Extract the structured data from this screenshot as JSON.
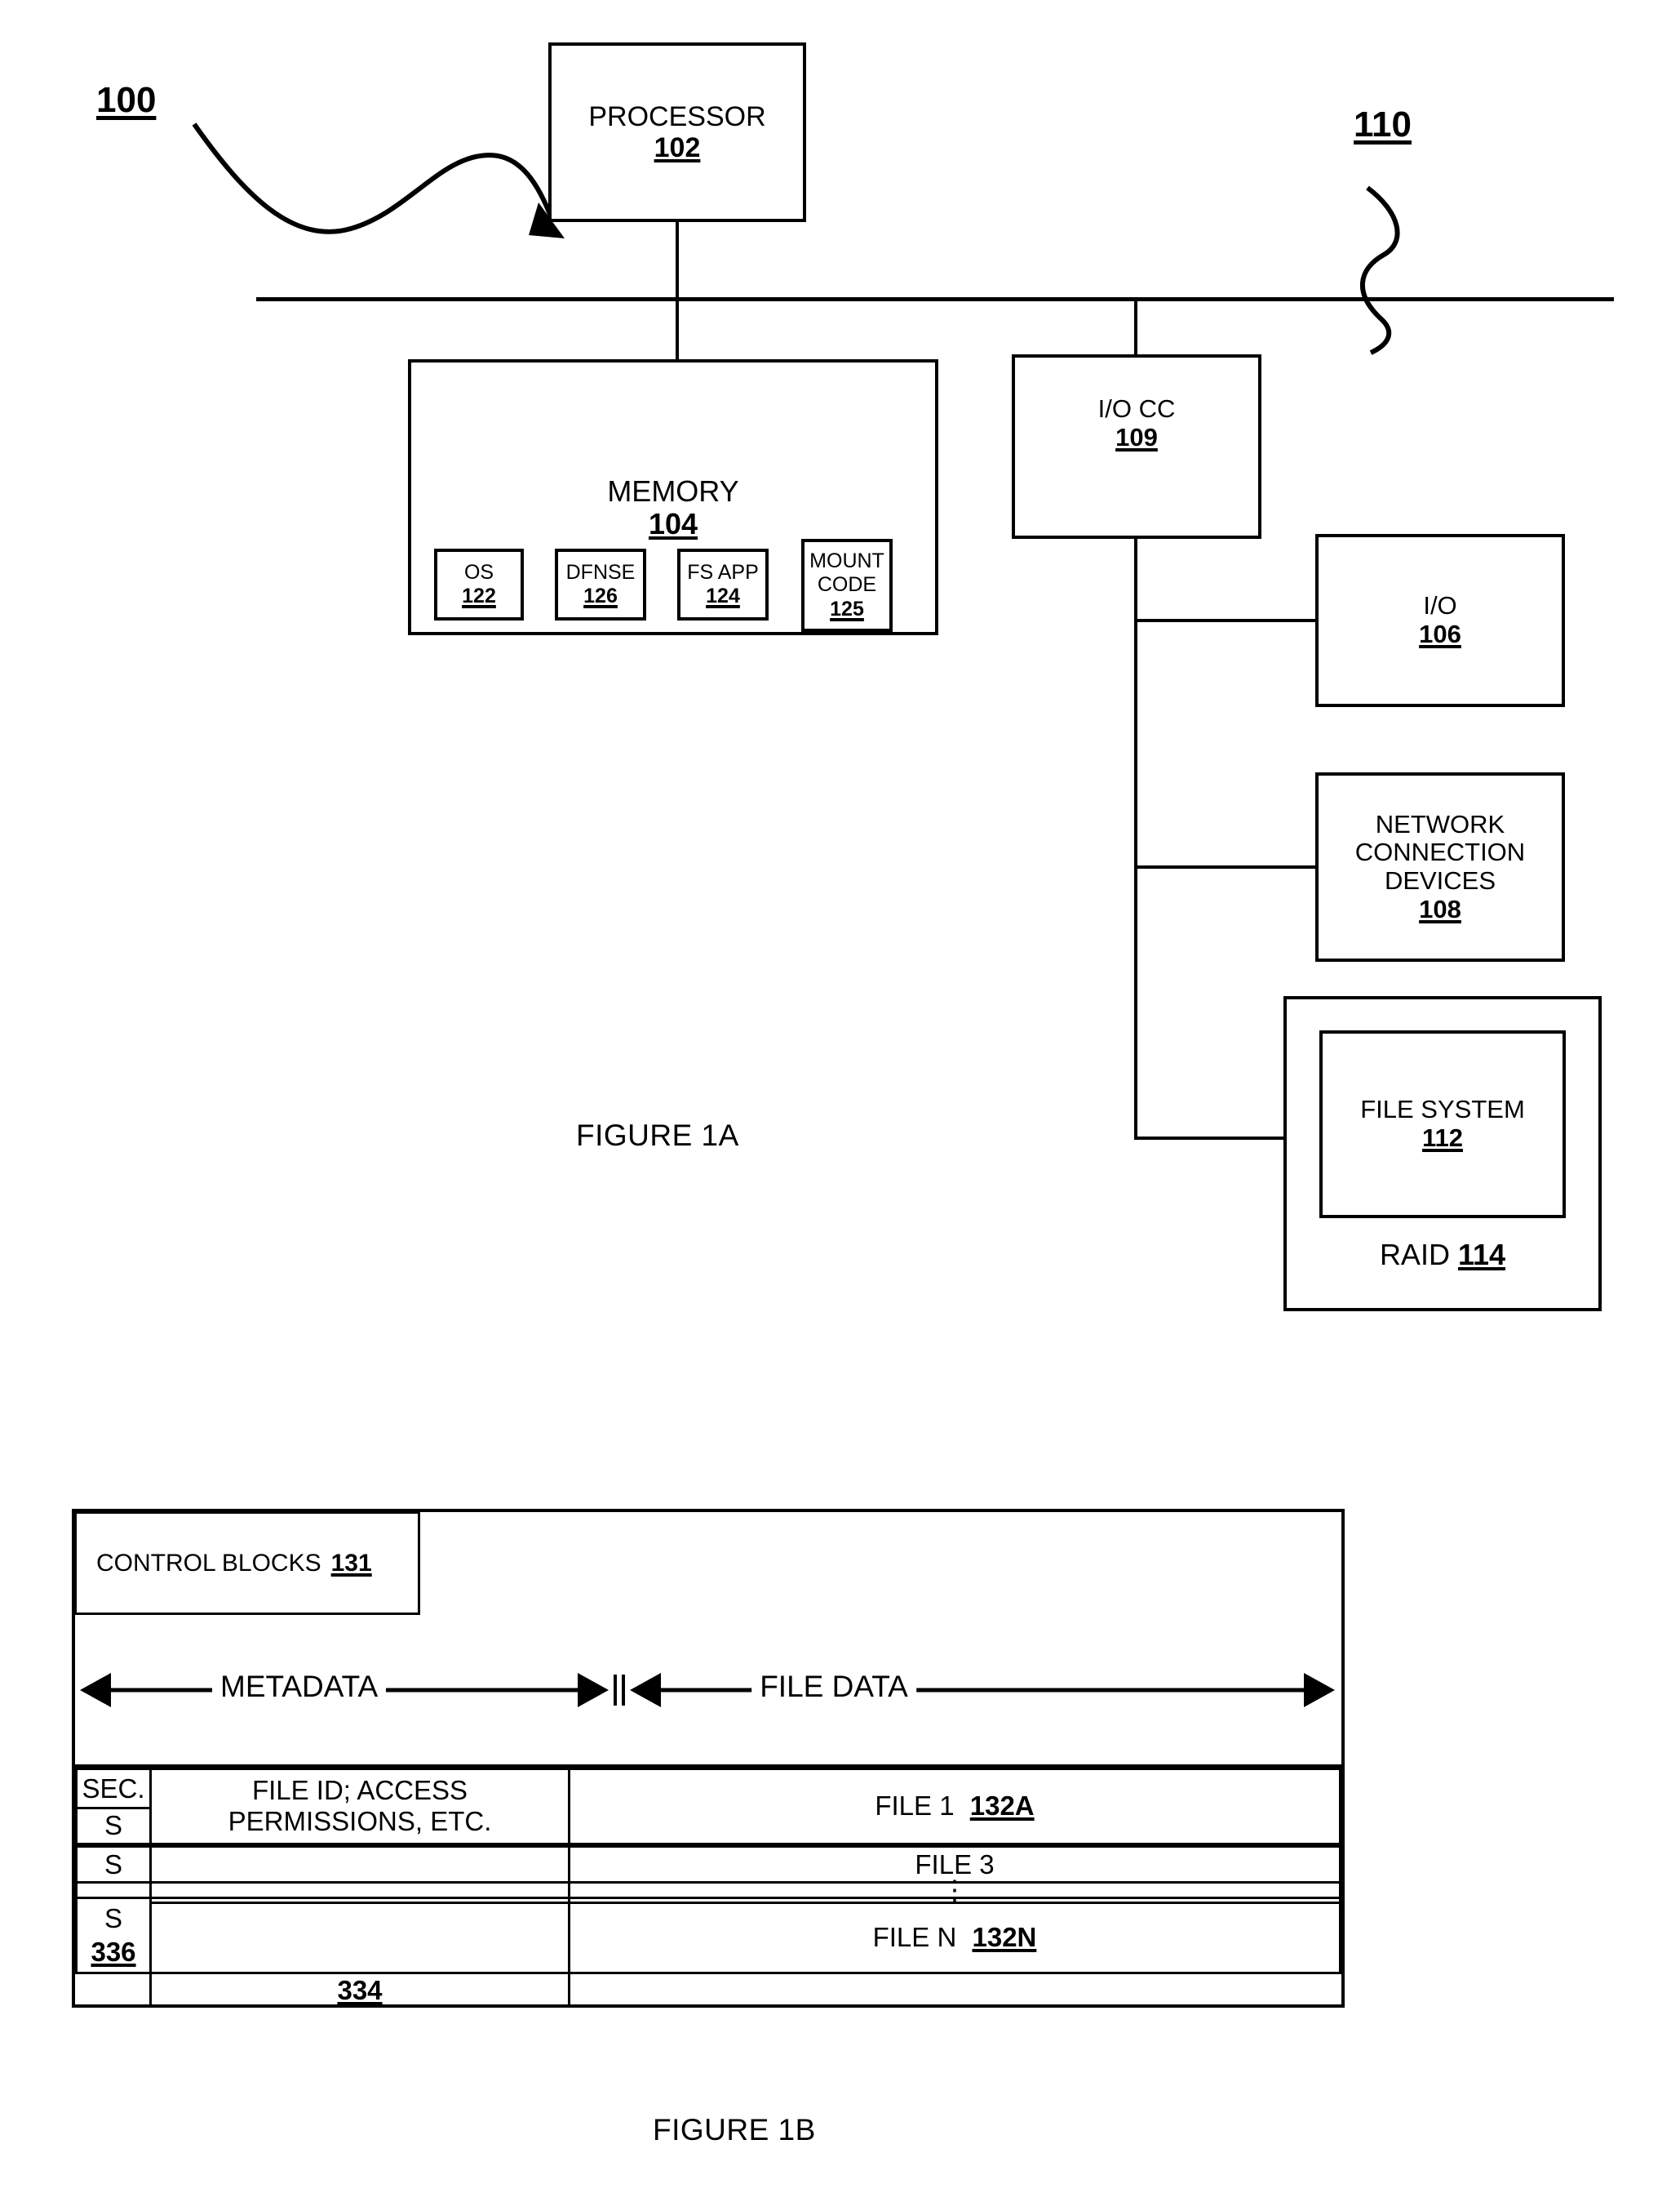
{
  "figure_1a": {
    "caption": "FIGURE 1A",
    "system_label": "100",
    "bus_label": "110",
    "processor": {
      "title": "PROCESSOR",
      "ref": "102"
    },
    "memory": {
      "title": "MEMORY",
      "ref": "104",
      "components": [
        {
          "title": "OS",
          "ref": "122"
        },
        {
          "title": "DFNSE",
          "ref": "126"
        },
        {
          "title": "FS APP",
          "ref": "124"
        },
        {
          "title": "MOUNT",
          "title2": "CODE",
          "ref": "125"
        }
      ]
    },
    "io_controller": {
      "title": "I/O CC",
      "ref": "109"
    },
    "io": {
      "title": "I/O",
      "ref": "106"
    },
    "network_devices": {
      "title_line1": "NETWORK",
      "title_line2": "CONNECTION",
      "title_line3": "DEVICES",
      "ref": "108"
    },
    "file_system": {
      "title": "FILE SYSTEM",
      "ref": "112"
    },
    "raid": {
      "title": "RAID",
      "ref": "114"
    }
  },
  "figure_1b": {
    "caption": "FIGURE 1B",
    "control_blocks": {
      "label": "CONTROL BLOCKS",
      "ref": "131"
    },
    "span_labels": {
      "metadata": "METADATA",
      "file_data": "FILE DATA"
    },
    "columns": {
      "sec": "SEC.",
      "metadata_header_line1": "FILE ID; ACCESS",
      "metadata_header_line2": "PERMISSIONS, ETC."
    },
    "metadata_ref": "334",
    "sec_ref": "336",
    "rows": [
      {
        "sec": "SEC.",
        "sec2": "S",
        "meta_line1": "FILE ID; ACCESS",
        "meta_line2": "PERMISSIONS, ETC.",
        "file": "FILE 1",
        "file_ref": "132A"
      },
      {
        "sec": "",
        "meta": "",
        "file": ""
      },
      {
        "sec": "S",
        "meta": "",
        "file": "FILE 3"
      },
      {
        "sec": "",
        "meta": "",
        "file": "⋮"
      },
      {
        "sec": "S",
        "meta": "",
        "file": ""
      },
      {
        "sec": "336",
        "meta": "",
        "file": "FILE N",
        "file_ref": "132N"
      },
      {
        "sec": "",
        "meta": "334",
        "file": ""
      }
    ]
  }
}
